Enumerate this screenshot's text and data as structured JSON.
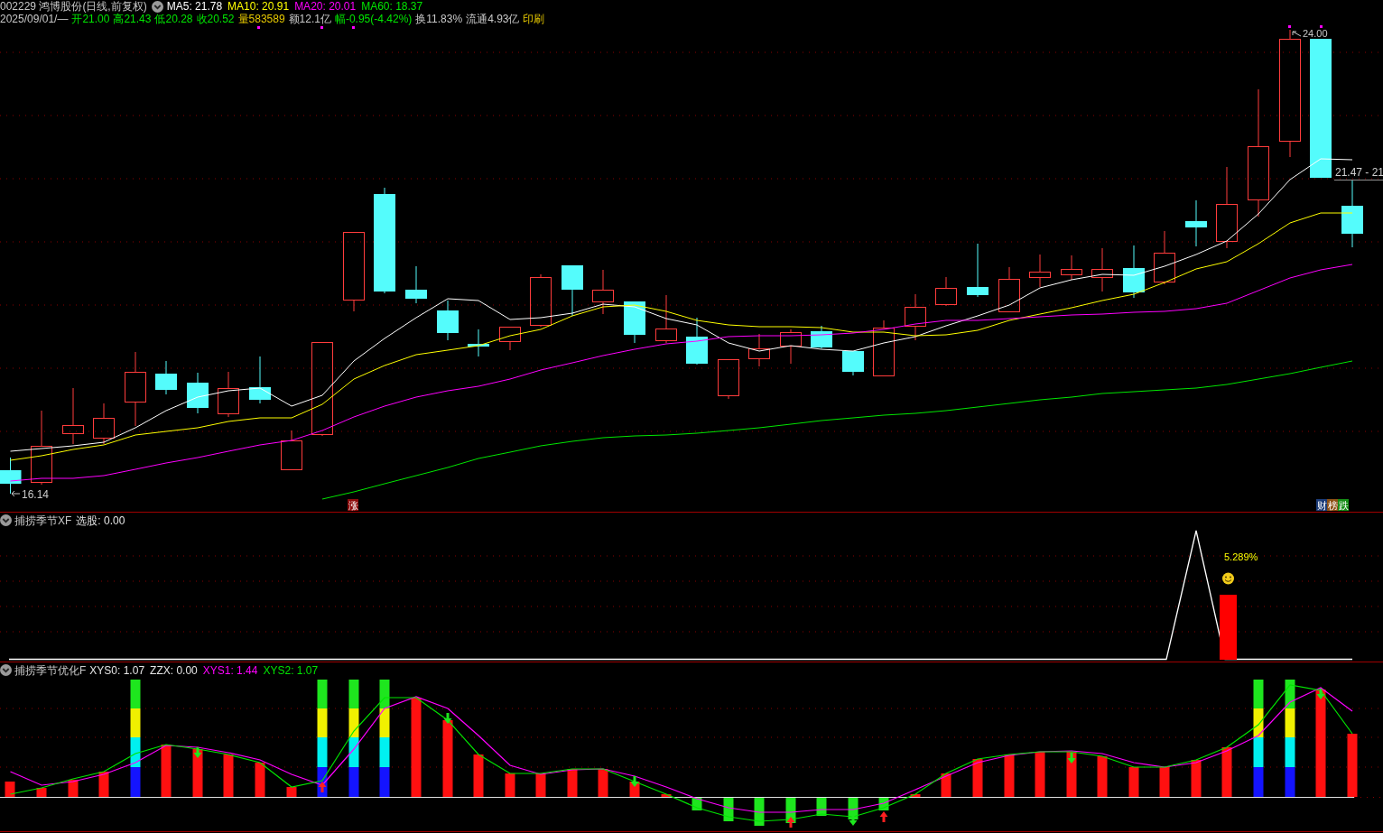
{
  "header": {
    "title": "002229 鸿博股份(日线,前复权)",
    "indicators": [
      {
        "label": "MA5: 21.78",
        "color": "#ffffff"
      },
      {
        "label": "MA10: 20.91",
        "color": "#ffff00"
      },
      {
        "label": "MA20: 20.01",
        "color": "#ff00ff"
      },
      {
        "label": "MA60: 18.37",
        "color": "#00e600"
      }
    ],
    "quote": [
      {
        "text": "2025/09/01/—",
        "color": "#c8c8c8"
      },
      {
        "text": "开21.00",
        "color": "#00e600"
      },
      {
        "text": "高21.43",
        "color": "#00e600"
      },
      {
        "text": "低20.28",
        "color": "#00e600"
      },
      {
        "text": "收20.52",
        "color": "#00e600"
      },
      {
        "text": "量583589",
        "color": "#e6c800"
      },
      {
        "text": "额12.1亿",
        "color": "#c8c8c8"
      },
      {
        "text": "幅-0.95(-4.42%)",
        "color": "#00e600"
      },
      {
        "text": "换11.83%",
        "color": "#c8c8c8"
      },
      {
        "text": "流通4.93亿",
        "color": "#c8c8c8"
      },
      {
        "text": "印刷",
        "color": "#e6c800"
      }
    ]
  },
  "main_chart": {
    "high_label": "24.00",
    "low_label": "16.14",
    "price_tag": "21.47 - 21",
    "badges": [
      {
        "text": "涨",
        "color": "#8c0a0a"
      }
    ],
    "corner_badges": [
      {
        "text": "财",
        "color": "#1c3c78"
      },
      {
        "text": "榜",
        "color": "#8c5014"
      },
      {
        "text": "跌",
        "color": "#148c14"
      }
    ]
  },
  "panel_2": {
    "title": "捕捞季节XF",
    "value": "选股: 0.00",
    "annotation": "5.289%"
  },
  "panel_3": {
    "title": "捕捞季节优化F",
    "values": [
      {
        "label": "XYS0: 1.07",
        "color": "#e6e6e6"
      },
      {
        "label": "ZZX: 0.00",
        "color": "#e6e6e6"
      },
      {
        "label": "XYS1: 1.44",
        "color": "#ff00ff"
      },
      {
        "label": "XYS2: 1.07",
        "color": "#00e600"
      }
    ]
  }
}
